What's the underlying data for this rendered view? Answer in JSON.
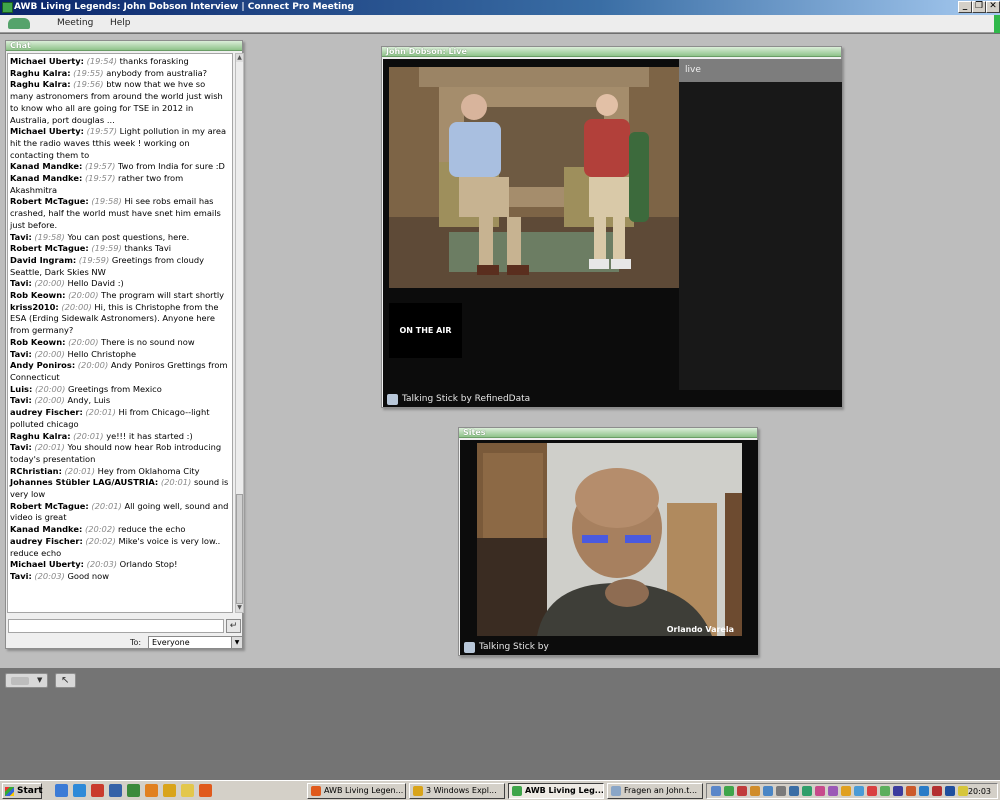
{
  "window": {
    "title": "AWB Living Legends: John Dobson Interview | Connect Pro Meeting",
    "controls": [
      "_",
      "❐",
      "✕"
    ]
  },
  "menu": [
    "Meeting",
    "Help"
  ],
  "chat": {
    "title": "Chat",
    "messages": [
      {
        "sender": "Michael Uberty:",
        "time": "(19:54)",
        "text": "thanks forasking"
      },
      {
        "sender": "Raghu Kalra:",
        "time": "(19:55)",
        "text": "anybody from australia?"
      },
      {
        "sender": "Raghu Kalra:",
        "time": "(19:56)",
        "text": "btw now that we hve so many astronomers from around the world just wish to know who all are going for TSE in 2012 in Australia, port douglas ..."
      },
      {
        "sender": "Michael Uberty:",
        "time": "(19:57)",
        "text": "Light pollution in my area hit the radio waves tthis week ! working on contacting them to"
      },
      {
        "sender": "Kanad Mandke:",
        "time": "(19:57)",
        "text": "Two from India for sure :D"
      },
      {
        "sender": "Kanad Mandke:",
        "time": "(19:57)",
        "text": "rather two from Akashmitra"
      },
      {
        "sender": "Robert McTague:",
        "time": "(19:58)",
        "text": "Hi see robs  email has crashed,  half the world must have snet him emails just before."
      },
      {
        "sender": "Tavi:",
        "time": "(19:58)",
        "text": "You can post questions, here."
      },
      {
        "sender": "Robert McTague:",
        "time": "(19:59)",
        "text": "thanks Tavi"
      },
      {
        "sender": "David Ingram:",
        "time": "(19:59)",
        "text": "Greetings from cloudy Seattle, Dark Skies NW"
      },
      {
        "sender": "Tavi:",
        "time": "(20:00)",
        "text": "Hello David :)"
      },
      {
        "sender": "Rob Keown:",
        "time": "(20:00)",
        "text": "The program will start shortly"
      },
      {
        "sender": "kriss2010:",
        "time": "(20:00)",
        "text": "Hi, this is Christophe from the ESA (Erding Sidewalk Astronomers). Anyone here from germany?"
      },
      {
        "sender": "Rob Keown:",
        "time": "(20:00)",
        "text": "There is no sound now"
      },
      {
        "sender": "Tavi:",
        "time": "(20:00)",
        "text": "Hello Christophe"
      },
      {
        "sender": "Andy Poniros:",
        "time": "(20:00)",
        "text": "Andy Poniros Grettings from Connecticut"
      },
      {
        "sender": "Luis:",
        "time": "(20:00)",
        "text": "Greetings from Mexico"
      },
      {
        "sender": "Tavi:",
        "time": "(20:00)",
        "text": "Andy, Luis"
      },
      {
        "sender": "audrey Fischer:",
        "time": "(20:01)",
        "text": "Hi from Chicago--light polluted chicago"
      },
      {
        "sender": "Raghu Kalra:",
        "time": "(20:01)",
        "text": "ye!!! it has started :)"
      },
      {
        "sender": "Tavi:",
        "time": "(20:01)",
        "text": "You should now hear Rob introducing today's presentation"
      },
      {
        "sender": "RChristian:",
        "time": "(20:01)",
        "text": "Hey from Oklahoma City"
      },
      {
        "sender": "Johannes Stübler LAG/AUSTRIA:",
        "time": "(20:01)",
        "text": "sound is very  low"
      },
      {
        "sender": "Robert McTague:",
        "time": "(20:01)",
        "text": "All going well, sound and video is great"
      },
      {
        "sender": "Kanad Mandke:",
        "time": "(20:02)",
        "text": "reduce the echo"
      },
      {
        "sender": "audrey Fischer:",
        "time": "(20:02)",
        "text": "Mike's voice is very low.. reduce echo"
      },
      {
        "sender": "Michael Uberty:",
        "time": "(20:03)",
        "text": "Orlando Stop!"
      },
      {
        "sender": "Tavi:",
        "time": "(20:03)",
        "text": "Good now"
      }
    ],
    "to_label": "To:",
    "to_value": "Everyone",
    "send_symbol": "↵"
  },
  "live_pod": {
    "title": "John Dobson: Live",
    "side_label": "live",
    "on_air": "ON THE AIR",
    "footer": "Talking Stick by RefinedData"
  },
  "sites_pod": {
    "title": "Sites",
    "caption": "Orlando Varela",
    "footer": "Talking Stick by"
  },
  "taskbar": {
    "start": "Start",
    "tasks": [
      {
        "label": "AWB Living Legen...",
        "active": false
      },
      {
        "label": "3 Windows Expl...",
        "active": false
      },
      {
        "label": "AWB Living Leg...",
        "active": true
      },
      {
        "label": "Fragen an John.t...",
        "active": false
      }
    ],
    "clock": "20:03"
  },
  "colors": {
    "title_bar": "#0a246a",
    "pod_header": "#8fc38a",
    "stage": "#bdbdbd",
    "taskbar": "#d4d0c8"
  }
}
